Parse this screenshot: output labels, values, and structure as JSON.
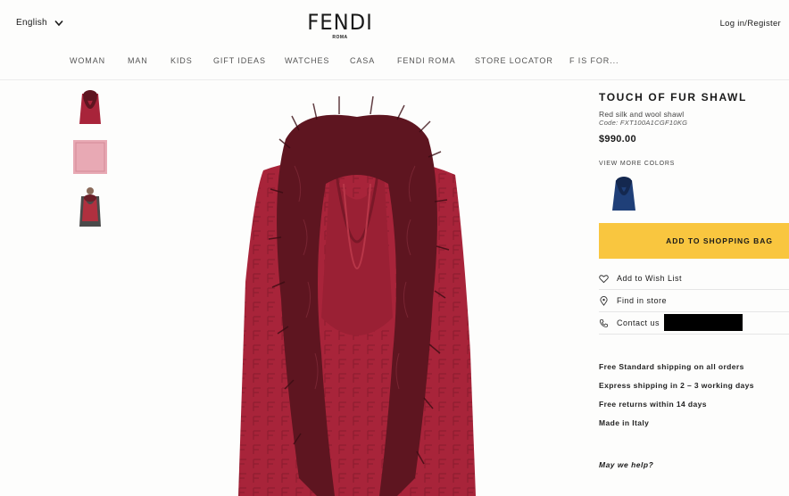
{
  "header": {
    "language": "English",
    "brand": "FENDI",
    "brand_sub": "ROMA",
    "login": "Log in/Register"
  },
  "nav": {
    "items": [
      {
        "label": "WOMAN"
      },
      {
        "label": "MAN"
      },
      {
        "label": "KIDS"
      },
      {
        "label": "GIFT IDEAS"
      },
      {
        "label": "WATCHES"
      },
      {
        "label": "CASA"
      },
      {
        "label": "FENDI ROMA"
      },
      {
        "label": "STORE LOCATOR"
      },
      {
        "label": "F IS FOR..."
      }
    ]
  },
  "product": {
    "name": "TOUCH OF FUR SHAWL",
    "description": "Red silk and wool shawl",
    "code": "Code: FXT100A1CGF10KG",
    "price": "$990.00",
    "view_more_colors": "VIEW MORE COLORS",
    "add_to_bag": "ADD TO SHOPPING BAG"
  },
  "actions": {
    "wishlist": "Add to Wish List",
    "find_store": "Find in store",
    "contact": "Contact us"
  },
  "shipping": [
    "Free Standard shipping on all orders",
    "Express shipping in 2 – 3 working days",
    "Free returns within 14 days",
    "Made in Italy"
  ],
  "help": "May we help?",
  "colors": {
    "accent": "#f9c63f",
    "shawl": "#a8243a",
    "fur": "#5e1520",
    "alt_color_swatch": "#1f3f78"
  }
}
